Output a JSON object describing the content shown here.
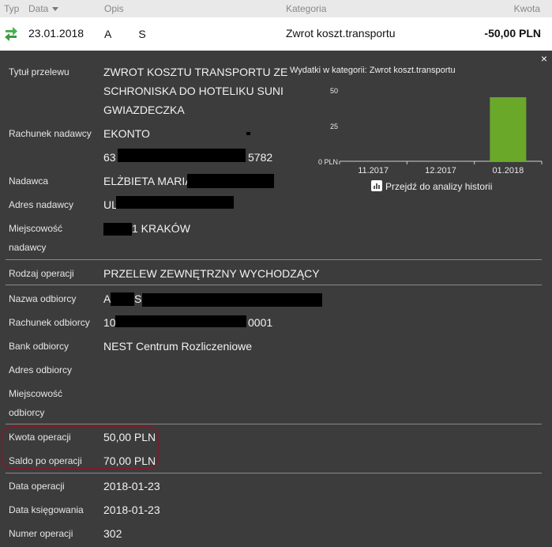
{
  "header": {
    "typ": "Typ",
    "data": "Data",
    "opis": "Opis",
    "kategoria": "Kategoria",
    "kwota": "Kwota"
  },
  "transaction": {
    "date": "23.01.2018",
    "opis_a": "A",
    "opis_b": "S",
    "kategoria": "Zwrot koszt.transportu",
    "kwota": "-50,00 PLN"
  },
  "details": {
    "close": "×",
    "tytul_label": "Tytuł przelewu",
    "tytul_lines": [
      "ZWROT KOSZTU TRANSPORTU ZE",
      "SCHRONISKA DO HOTELIKU SUNI",
      "GWIAZDECZKA"
    ],
    "rachunek_nadawcy_label": "Rachunek nadawcy",
    "rachunek_nadawcy_line1": "EKONTO",
    "rachunek_nadawcy_prefix": "63",
    "rachunek_nadawcy_suffix": "5782",
    "nadawca_label": "Nadawca",
    "nadawca_value": "ELŻBIETA MARIA N",
    "adres_nadawcy_label": "Adres nadawcy",
    "adres_nadawcy_value": "UL",
    "miejscowosc_nadawcy_label_1": "Miejscowość",
    "miejscowosc_nadawcy_label_2": "nadawcy",
    "miejscowosc_nadawcy_value": "1 KRAKÓW",
    "rodzaj_label": "Rodzaj operacji",
    "rodzaj_value": "PRZELEW ZEWNĘTRZNY WYCHODZĄCY",
    "nazwa_odbiorcy_label": "Nazwa odbiorcy",
    "nazwa_odbiorcy_a": "A",
    "nazwa_odbiorcy_b": "S",
    "rachunek_odbiorcy_label": "Rachunek odbiorcy",
    "rachunek_odbiorcy_prefix": "10",
    "rachunek_odbiorcy_suffix": "0001",
    "bank_odbiorcy_label": "Bank odbiorcy",
    "bank_odbiorcy_value": "NEST Centrum Rozliczeniowe",
    "adres_odbiorcy_label": "Adres odbiorcy",
    "miejscowosc_odbiorcy_label_1": "Miejscowość",
    "miejscowosc_odbiorcy_label_2": "odbiorcy",
    "kwota_label": "Kwota operacji",
    "kwota_value": "50,00 PLN",
    "saldo_label": "Saldo po operacji",
    "saldo_value": "70,00 PLN",
    "data_operacji_label": "Data operacji",
    "data_operacji_value": "2018-01-23",
    "data_ksiegowania_label": "Data księgowania",
    "data_ksiegowania_value": "2018-01-23",
    "numer_label": "Numer operacji",
    "numer_value": "302"
  },
  "chart_data": {
    "type": "bar",
    "title": "Wydatki w kategorii:  Zwrot koszt.transportu",
    "categories": [
      "11.2017",
      "12.2017",
      "01.2018"
    ],
    "values": [
      0,
      0,
      45
    ],
    "y_ticks": [
      "0 PLN",
      "25",
      "50"
    ],
    "ylim": [
      0,
      50
    ],
    "color": "#6aa82a",
    "link": "Przejdź do analizy historii"
  },
  "colors": {
    "panel_bg": "#3c3c3c",
    "highlight": "#7a1d2b",
    "transfer_icon": "#4caf50"
  }
}
